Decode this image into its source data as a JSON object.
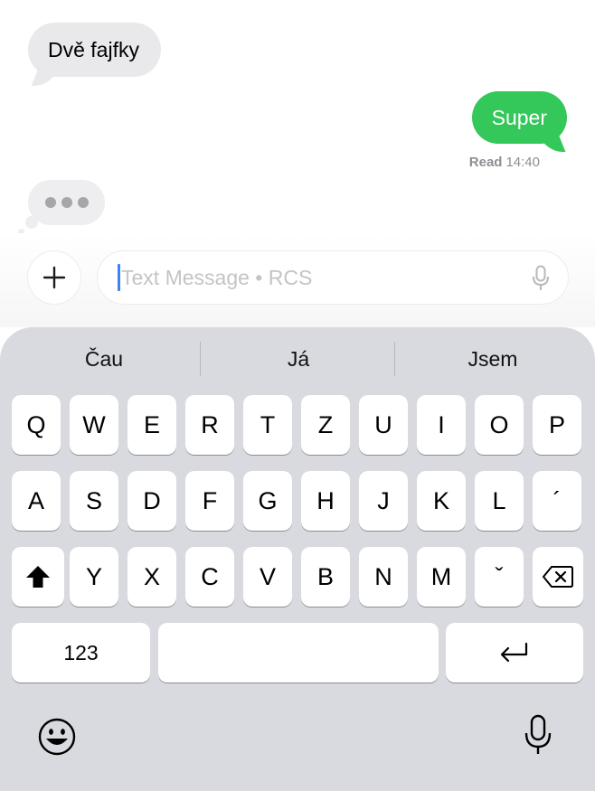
{
  "messages": {
    "incoming_text": "Dvě fajfky",
    "outgoing_text": "Super",
    "receipt_status": "Read",
    "receipt_time": "14:40"
  },
  "composer": {
    "placeholder": "Text Message • RCS"
  },
  "keyboard": {
    "suggestions": [
      "Čau",
      "Já",
      "Jsem"
    ],
    "row1": [
      "Q",
      "W",
      "E",
      "R",
      "T",
      "Z",
      "U",
      "I",
      "O",
      "P"
    ],
    "row2": [
      "A",
      "S",
      "D",
      "F",
      "G",
      "H",
      "J",
      "K",
      "L",
      "´"
    ],
    "row3": [
      "Y",
      "X",
      "C",
      "V",
      "B",
      "N",
      "M",
      "ˇ"
    ],
    "numbers_label": "123"
  },
  "icons": {
    "add": "plus-icon",
    "dictation": "microphone-icon",
    "shift": "shift-icon",
    "delete": "backspace-icon",
    "return": "return-icon",
    "emoji": "emoji-icon"
  },
  "colors": {
    "incoming_bubble": "#e9e9eb",
    "outgoing_bubble": "#34c759",
    "caret": "#3b82f6",
    "keyboard_bg": "#d9dadf"
  }
}
